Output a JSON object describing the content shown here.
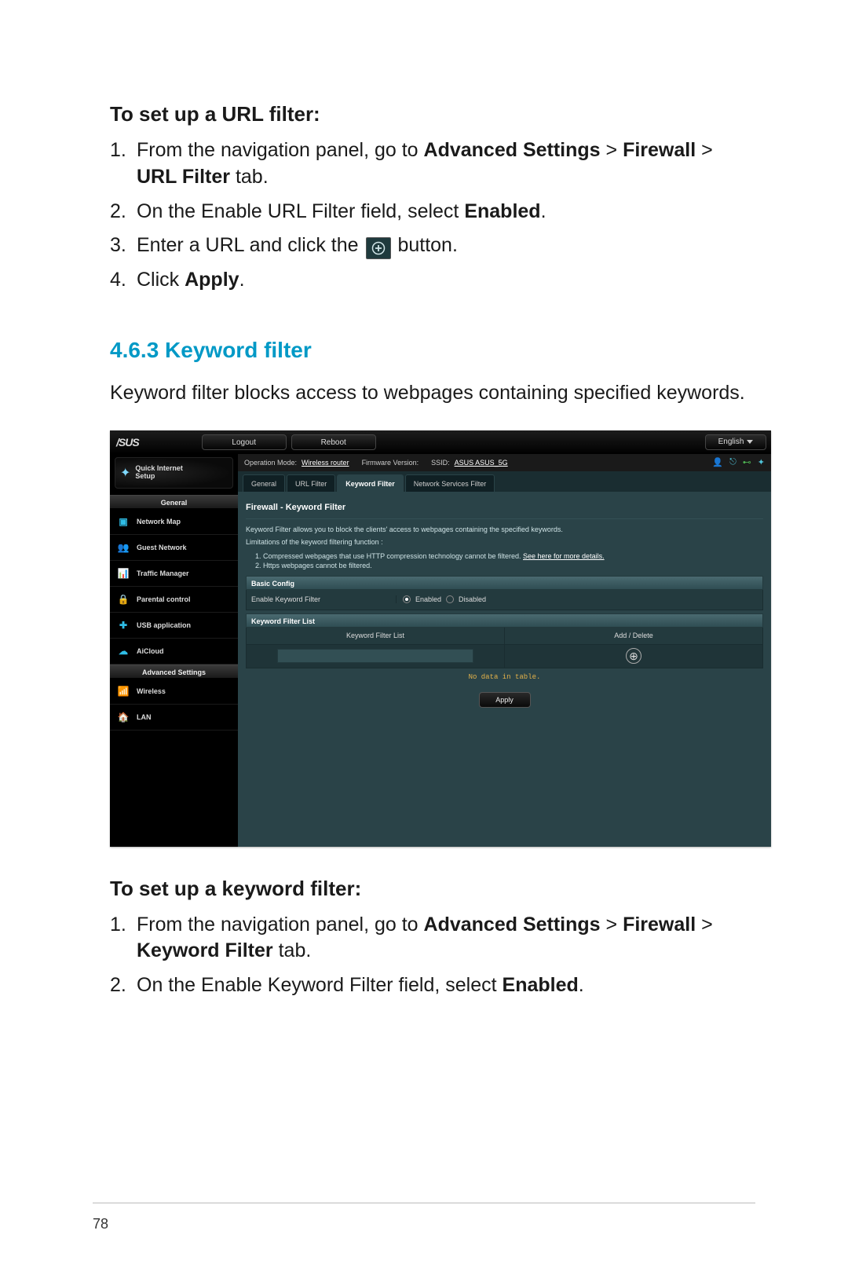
{
  "page_number": "78",
  "heading_url_filter": "To set up a URL filter:",
  "url_steps": {
    "s1_pre": "From the navigation panel, go to ",
    "s1_b1": "Advanced Settings",
    "s1_gt": " > ",
    "s1_b2": "Firewall",
    "s1_gt2": " > ",
    "s1_b3": "URL Filter",
    "s1_post": " tab.",
    "s2_pre": "On the Enable URL Filter field, select ",
    "s2_b": "Enabled",
    "s2_post": ".",
    "s3_pre": "Enter a URL and click the ",
    "s3_post": " button.",
    "s4_pre": "Click ",
    "s4_b": "Apply",
    "s4_post": "."
  },
  "section_title": "4.6.3  Keyword filter",
  "section_desc": "Keyword filter blocks access to webpages containing specified keywords.",
  "heading_kw_filter": "To set up a keyword filter:",
  "kw_steps": {
    "s1_pre": "From the navigation panel, go to ",
    "s1_b1": "Advanced Settings",
    "s1_gt": " > ",
    "s1_b2": "Firewall",
    "s1_gt2": " > ",
    "s1_b3": "Keyword Filter",
    "s1_post": " tab.",
    "s2_pre": "On the Enable Keyword Filter field, select ",
    "s2_b": "Enabled",
    "s2_post": "."
  },
  "shot": {
    "logo": "/SUS",
    "btn_logout": "Logout",
    "btn_reboot": "Reboot",
    "lang": "English",
    "qis1": "Quick Internet",
    "qis2": "Setup",
    "cat_general": "General",
    "cat_advanced": "Advanced Settings",
    "nav": {
      "map": "Network Map",
      "guest": "Guest Network",
      "traffic": "Traffic Manager",
      "parental": "Parental control",
      "usb": "USB application",
      "aicloud": "AiCloud",
      "wireless": "Wireless",
      "lan": "LAN"
    },
    "status": {
      "op_lbl": "Operation Mode:",
      "op_val": "Wireless router",
      "fw_lbl": "Firmware Version:",
      "ssid_lbl": "SSID:",
      "ssid_val": "ASUS  ASUS_5G"
    },
    "tabs": [
      "General",
      "URL Filter",
      "Keyword Filter",
      "Network Services Filter"
    ],
    "panel_title": "Firewall - Keyword Filter",
    "panel_desc": "Keyword Filter allows you to block the clients' access to webpages containing the specified keywords.",
    "lim_title": "Limitations of the keyword filtering function :",
    "lim1_a": "Compressed webpages that use HTTP compression technology cannot be filtered. ",
    "lim1_b": "See here for more details.",
    "lim2": "Https webpages cannot be filtered.",
    "sect_basic": "Basic Config",
    "row_enable": "Enable Keyword Filter",
    "opt_enabled": "Enabled",
    "opt_disabled": "Disabled",
    "sect_list": "Keyword Filter List",
    "th1": "Keyword Filter List",
    "th2": "Add / Delete",
    "nodata": "No data in table.",
    "apply": "Apply"
  }
}
